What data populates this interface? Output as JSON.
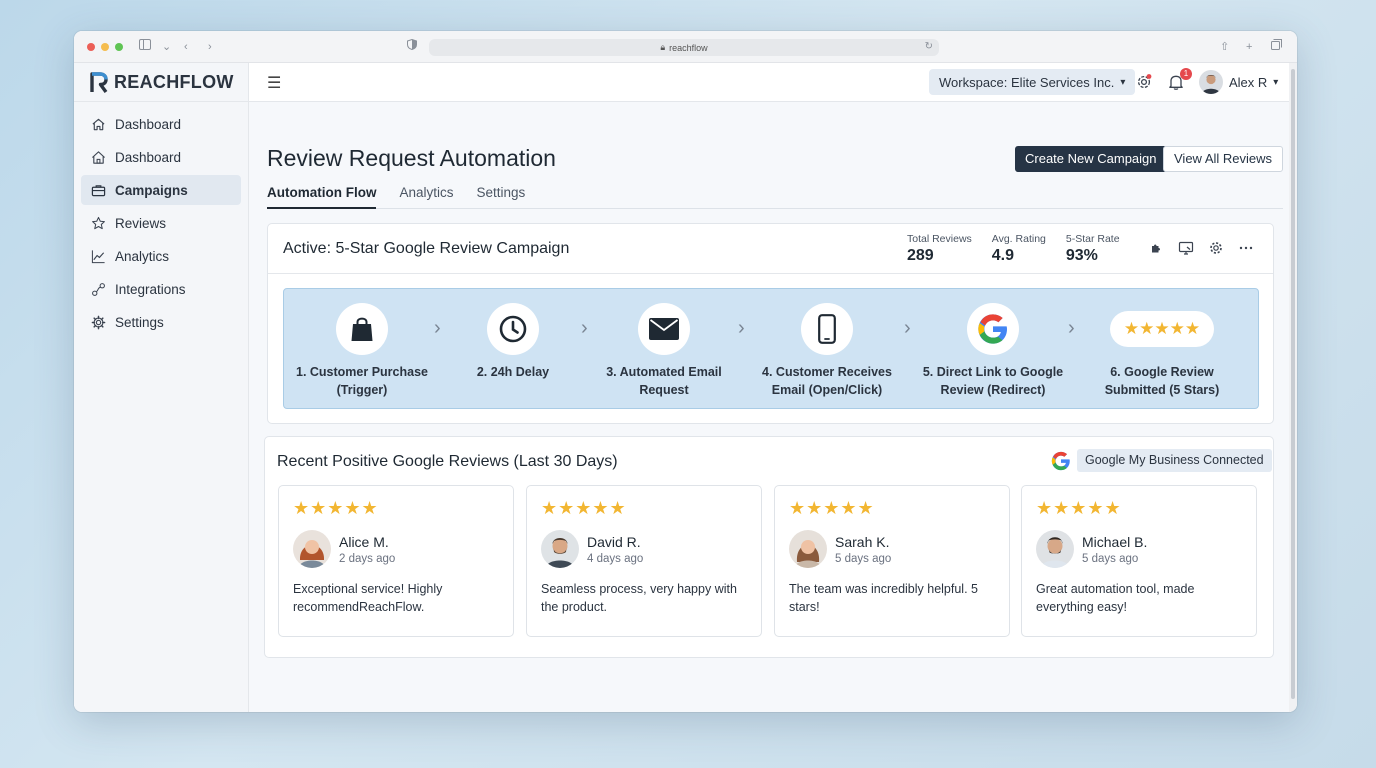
{
  "browser": {
    "url": "reachflow",
    "traffic_colors": [
      "#ec5f57",
      "#f5bd4f",
      "#5fc454"
    ]
  },
  "brand": {
    "name": "REACHFLOW",
    "accent": "#3d8fd1"
  },
  "sidebar": {
    "items": [
      {
        "label": "Dashboard",
        "icon": "home-icon"
      },
      {
        "label": "Dashboard",
        "icon": "house-icon"
      },
      {
        "label": "Campaigns",
        "icon": "briefcase-icon",
        "active": true
      },
      {
        "label": "Reviews",
        "icon": "star-outline-icon"
      },
      {
        "label": "Analytics",
        "icon": "line-chart-icon"
      },
      {
        "label": "Integrations",
        "icon": "integration-icon"
      },
      {
        "label": "Settings",
        "icon": "gear-icon"
      }
    ]
  },
  "topbar": {
    "workspace": "Workspace: Elite Services Inc.",
    "notification_count": "1",
    "user_name": "Alex R"
  },
  "page": {
    "title": "Review Request Automation",
    "primary_button": "Create New Campaign",
    "secondary_button": "View All Reviews",
    "tabs": [
      {
        "label": "Automation Flow",
        "active": true
      },
      {
        "label": "Analytics"
      },
      {
        "label": "Settings"
      }
    ]
  },
  "campaign": {
    "title": "Active: 5-Star Google Review Campaign",
    "stats": [
      {
        "label": "Total Reviews",
        "value": "289"
      },
      {
        "label": "Avg. Rating",
        "value": "4.9"
      },
      {
        "label": "5-Star Rate",
        "value": "93%"
      }
    ],
    "steps": [
      {
        "line1": "1. Customer Purchase",
        "line2": "(Trigger)",
        "icon": "shopping-bag-icon"
      },
      {
        "line1": "2. 24h Delay",
        "line2": "",
        "icon": "clock-icon"
      },
      {
        "line1": "3. Automated Email",
        "line2": "Request",
        "icon": "envelope-icon"
      },
      {
        "line1": "4. Customer Receives",
        "line2": "Email (Open/Click)",
        "icon": "smartphone-icon"
      },
      {
        "line1": "5. Direct Link to Google",
        "line2": "Review (Redirect)",
        "icon": "google-logo-icon"
      },
      {
        "line1": "6. Google Review",
        "line2": "Submitted (5 Stars)",
        "icon": "five-stars-icon"
      }
    ]
  },
  "reviews": {
    "title": "Recent Positive Google Reviews (Last 30 Days)",
    "connection": "Google My Business Connected",
    "star_color": "#f2b632",
    "items": [
      {
        "name": "Alice M.",
        "time": "2 days ago",
        "text": "Exceptional service! Highly recommendReachFlow.",
        "rating": 5
      },
      {
        "name": "David R.",
        "time": "4 days ago",
        "text": "Seamless process, very happy with the product.",
        "rating": 5
      },
      {
        "name": "Sarah K.",
        "time": "5 days ago",
        "text": "The team was incredibly helpful. 5 stars!",
        "rating": 5
      },
      {
        "name": "Michael B.",
        "time": "5 days ago",
        "text": "Great automation tool, made everything easy!",
        "rating": 5
      }
    ]
  }
}
